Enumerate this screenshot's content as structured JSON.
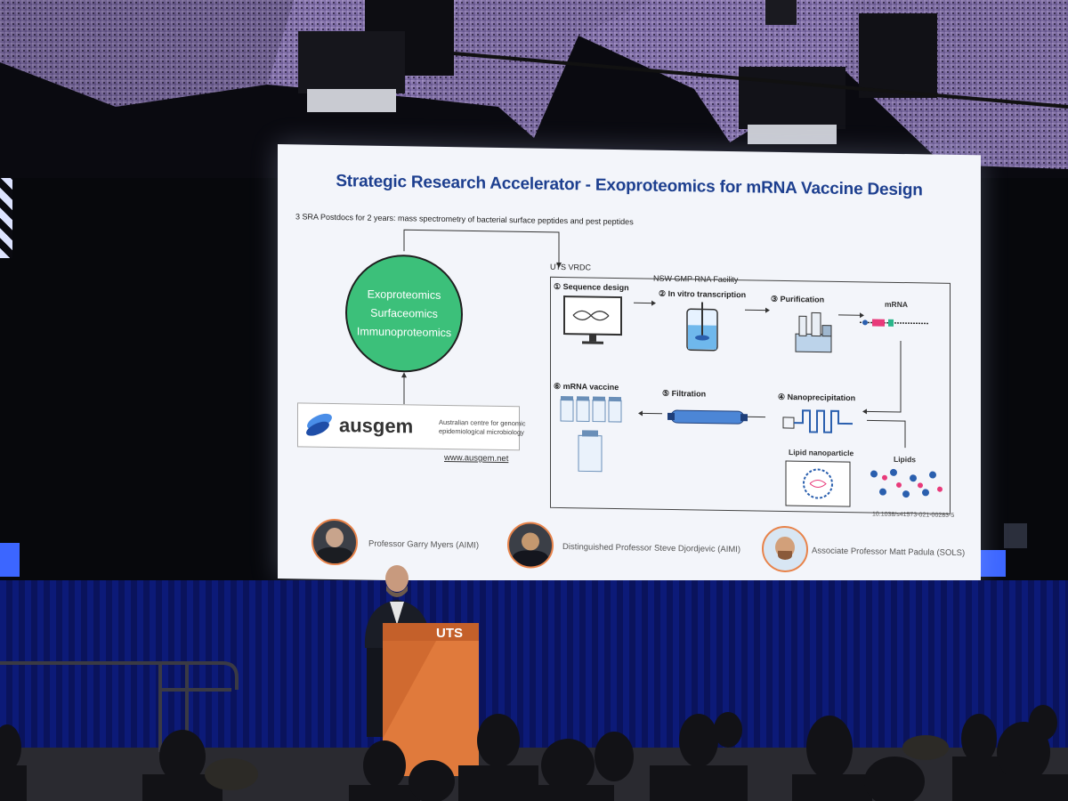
{
  "slide": {
    "title": "Strategic Research Accelerator - Exoproteomics for mRNA Vaccine Design",
    "subtitle": "3 SRA Postdocs for 2 years: mass spectrometry of bacterial surface peptides and pest peptides",
    "circle_items": [
      "Exoproteomics",
      "Surfaceomics",
      "Immunoproteomics"
    ],
    "logo": {
      "name": "ausgem",
      "tagline_1": "Australian centre for genomic",
      "tagline_2": "epidemiological microbiology",
      "url": "www.ausgem.net"
    },
    "uts_vrdc": "UTS VRDC",
    "facility": "NSW GMP RNA Facility",
    "steps": {
      "s1": "① Sequence design",
      "s2": "② In vitro transcription",
      "s3": "③ Purification",
      "s4": "④ Nanoprecipitation",
      "s5": "⑤ Filtration",
      "s6": "⑥ mRNA vaccine"
    },
    "mrna": "mRNA",
    "lipids": "Lipids",
    "lipid_np": "Lipid nanoparticle",
    "doi": "10.1038/s41573-021-00283-5",
    "people": [
      "Professor Garry Myers (AIMI)",
      "Distinguished Professor Steve Djordjevic (AIMI)",
      "Associate Professor Matt Padula (SOLS)"
    ]
  },
  "podium_label": "UTS",
  "colors": {
    "title": "#1d3f8f",
    "circle": "#3cc07a",
    "podium": "#e07a3c",
    "curtain": "#0c1a78",
    "ceiling": "#a58fd0"
  }
}
